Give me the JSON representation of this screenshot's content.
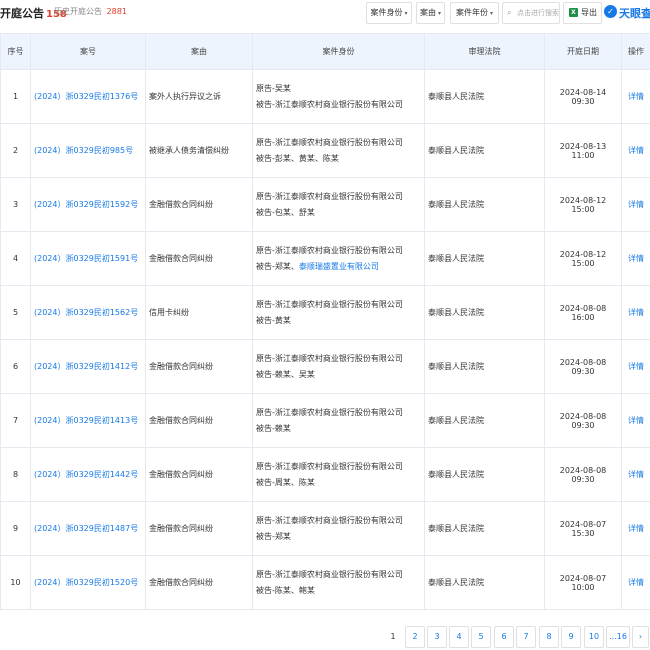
{
  "header": {
    "title": "开庭公告",
    "count": "158",
    "history_label": "历史开庭公告",
    "history_count": "2881",
    "filters": [
      "案件身份",
      "案由",
      "案件年份"
    ],
    "search_placeholder": "点击进行搜索",
    "export_label": "导出",
    "logo_text": "天眼查"
  },
  "table": {
    "columns": [
      "序号",
      "案号",
      "案由",
      "案件身份",
      "审理法院",
      "开庭日期",
      "操作"
    ],
    "rows": [
      {
        "no": "1",
        "case": "(2024）浙0329民初1376号",
        "cause": "案外人执行异议之诉",
        "plaintiff": "原告-吴某",
        "defendant_prefix": "被告-",
        "defendant": "浙江泰顺农村商业银行股份有限公司",
        "defendant_link": "",
        "court": "泰顺县人民法院",
        "date": "2024-08-14 09:30",
        "action": "详情"
      },
      {
        "no": "2",
        "case": "(2024）浙0329民初985号",
        "cause": "被继承人债务清偿纠纷",
        "plaintiff": "原告-浙江泰顺农村商业银行股份有限公司",
        "defendant_prefix": "被告-",
        "defendant": "彭某、黄某、陈某",
        "defendant_link": "",
        "court": "泰顺县人民法院",
        "date": "2024-08-13 11:00",
        "action": "详情"
      },
      {
        "no": "3",
        "case": "(2024）浙0329民初1592号",
        "cause": "金融借款合同纠纷",
        "plaintiff": "原告-浙江泰顺农村商业银行股份有限公司",
        "defendant_prefix": "被告-",
        "defendant": "包某、舒某",
        "defendant_link": "",
        "court": "泰顺县人民法院",
        "date": "2024-08-12 15:00",
        "action": "详情"
      },
      {
        "no": "4",
        "case": "(2024）浙0329民初1591号",
        "cause": "金融借款合同纠纷",
        "plaintiff": "原告-浙江泰顺农村商业银行股份有限公司",
        "defendant_prefix": "被告-",
        "defendant": "郑某、",
        "defendant_link": "泰顺瑞盛置业有限公司",
        "court": "泰顺县人民法院",
        "date": "2024-08-12 15:00",
        "action": "详情"
      },
      {
        "no": "5",
        "case": "(2024）浙0329民初1562号",
        "cause": "信用卡纠纷",
        "plaintiff": "原告-浙江泰顺农村商业银行股份有限公司",
        "defendant_prefix": "被告-",
        "defendant": "黄某",
        "defendant_link": "",
        "court": "泰顺县人民法院",
        "date": "2024-08-08 16:00",
        "action": "详情"
      },
      {
        "no": "6",
        "case": "(2024）浙0329民初1412号",
        "cause": "金融借款合同纠纷",
        "plaintiff": "原告-浙江泰顺农村商业银行股份有限公司",
        "defendant_prefix": "被告-",
        "defendant": "赖某、吴某",
        "defendant_link": "",
        "court": "泰顺县人民法院",
        "date": "2024-08-08 09:30",
        "action": "详情"
      },
      {
        "no": "7",
        "case": "(2024）浙0329民初1413号",
        "cause": "金融借款合同纠纷",
        "plaintiff": "原告-浙江泰顺农村商业银行股份有限公司",
        "defendant_prefix": "被告-",
        "defendant": "赖某",
        "defendant_link": "",
        "court": "泰顺县人民法院",
        "date": "2024-08-08 09:30",
        "action": "详情"
      },
      {
        "no": "8",
        "case": "(2024）浙0329民初1442号",
        "cause": "金融借款合同纠纷",
        "plaintiff": "原告-浙江泰顺农村商业银行股份有限公司",
        "defendant_prefix": "被告-",
        "defendant": "周某、陈某",
        "defendant_link": "",
        "court": "泰顺县人民法院",
        "date": "2024-08-08 09:30",
        "action": "详情"
      },
      {
        "no": "9",
        "case": "(2024）浙0329民初1487号",
        "cause": "金融借款合同纠纷",
        "plaintiff": "原告-浙江泰顺农村商业银行股份有限公司",
        "defendant_prefix": "被告-",
        "defendant": "郑某",
        "defendant_link": "",
        "court": "泰顺县人民法院",
        "date": "2024-08-07 15:30",
        "action": "详情"
      },
      {
        "no": "10",
        "case": "(2024）浙0329民初1520号",
        "cause": "金融借款合同纠纷",
        "plaintiff": "原告-浙江泰顺农村商业银行股份有限公司",
        "defendant_prefix": "被告-",
        "defendant": "陈某、鲍某",
        "defendant_link": "",
        "court": "泰顺县人民法院",
        "date": "2024-08-07 10:00",
        "action": "详情"
      }
    ]
  },
  "pagination": {
    "pages": [
      "1",
      "2",
      "3",
      "4",
      "5",
      "6",
      "7",
      "8",
      "9",
      "10",
      "...16"
    ],
    "current": "1",
    "next_icon": "chevron-right-icon"
  },
  "colors": {
    "link": "#1679e6",
    "accent_red": "#e0402b",
    "header_bg": "#eef4fd"
  }
}
